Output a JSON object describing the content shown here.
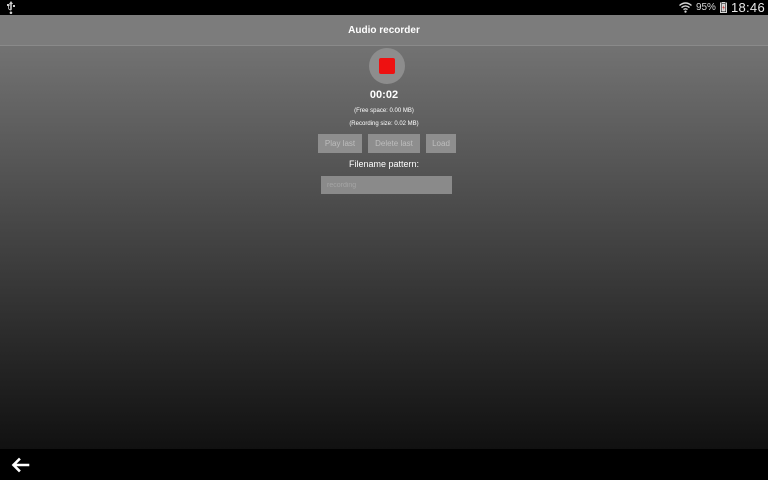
{
  "status_bar": {
    "battery_percent": "95%",
    "time": "18:46",
    "icons": [
      "usb-icon",
      "wifi-icon",
      "battery-icon"
    ]
  },
  "app": {
    "title": "Audio recorder",
    "record_button_state": "recording",
    "timer": "00:02",
    "free_space": "(Free space: 0.00 MB)",
    "recording_size": "(Recording size: 0.02 MB)",
    "buttons": {
      "play_last": "Play last",
      "delete_last": "Delete last",
      "load": "Load"
    },
    "filename_label": "Filename pattern:",
    "filename_placeholder": "recording"
  },
  "colors": {
    "stop_red": "#ee1111",
    "action_bar": "#7c7c7c"
  }
}
